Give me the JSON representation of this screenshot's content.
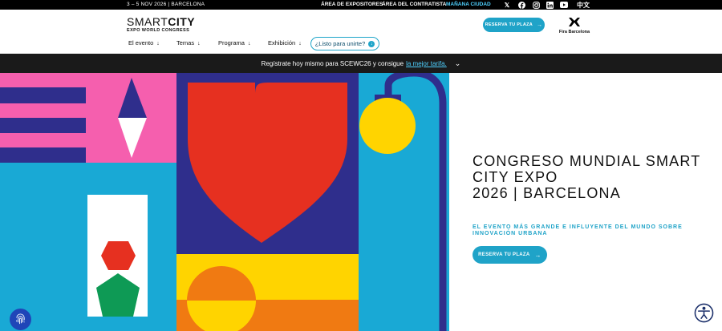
{
  "topbar": {
    "date": "3 – 5 NOV 2026 | BARCELONA",
    "links": [
      "ÁREA DE EXPOSITORES",
      "ÁREA DEL CONTRATISTA",
      "MAÑANA CIUDAD"
    ],
    "social": [
      "x-icon",
      "facebook-icon",
      "instagram-icon",
      "linkedin-icon",
      "youtube-icon"
    ],
    "lang": "中文"
  },
  "header": {
    "logo_light": "SMART",
    "logo_bold": "CITY",
    "logo_sub": "EXPO WORLD CONGRESS",
    "nav": [
      {
        "label": "El evento"
      },
      {
        "label": "Temas"
      },
      {
        "label": "Programa"
      },
      {
        "label": "Exhibición"
      }
    ],
    "cta_outline": "¿Listo para unirte?",
    "reserve": "RESERVA TU PLAZA",
    "partner": "Fira Barcelona"
  },
  "announce": {
    "text": "Regístrate hoy mismo para SCEWC26 y consigue",
    "link": "la mejor tarifa."
  },
  "hero": {
    "title_line1": "CONGRESO MUNDIAL SMART",
    "title_line2": "CITY EXPO",
    "title_line3": "2026 | BARCELONA",
    "subtitle": "EL EVENTO MÁS GRANDE E INFLUYENTE DEL MUNDO SOBRE INNOVACIÓN URBANA",
    "cta": "RESERVA TU PLAZA"
  },
  "colors": {
    "accent": "#1fa3c8",
    "navy": "#2f2e8c",
    "pink": "#f55fae",
    "cyan": "#19a9d5",
    "red": "#e63020",
    "yellow": "#ffd400",
    "orange": "#f07a12",
    "green": "#0e9a55"
  }
}
